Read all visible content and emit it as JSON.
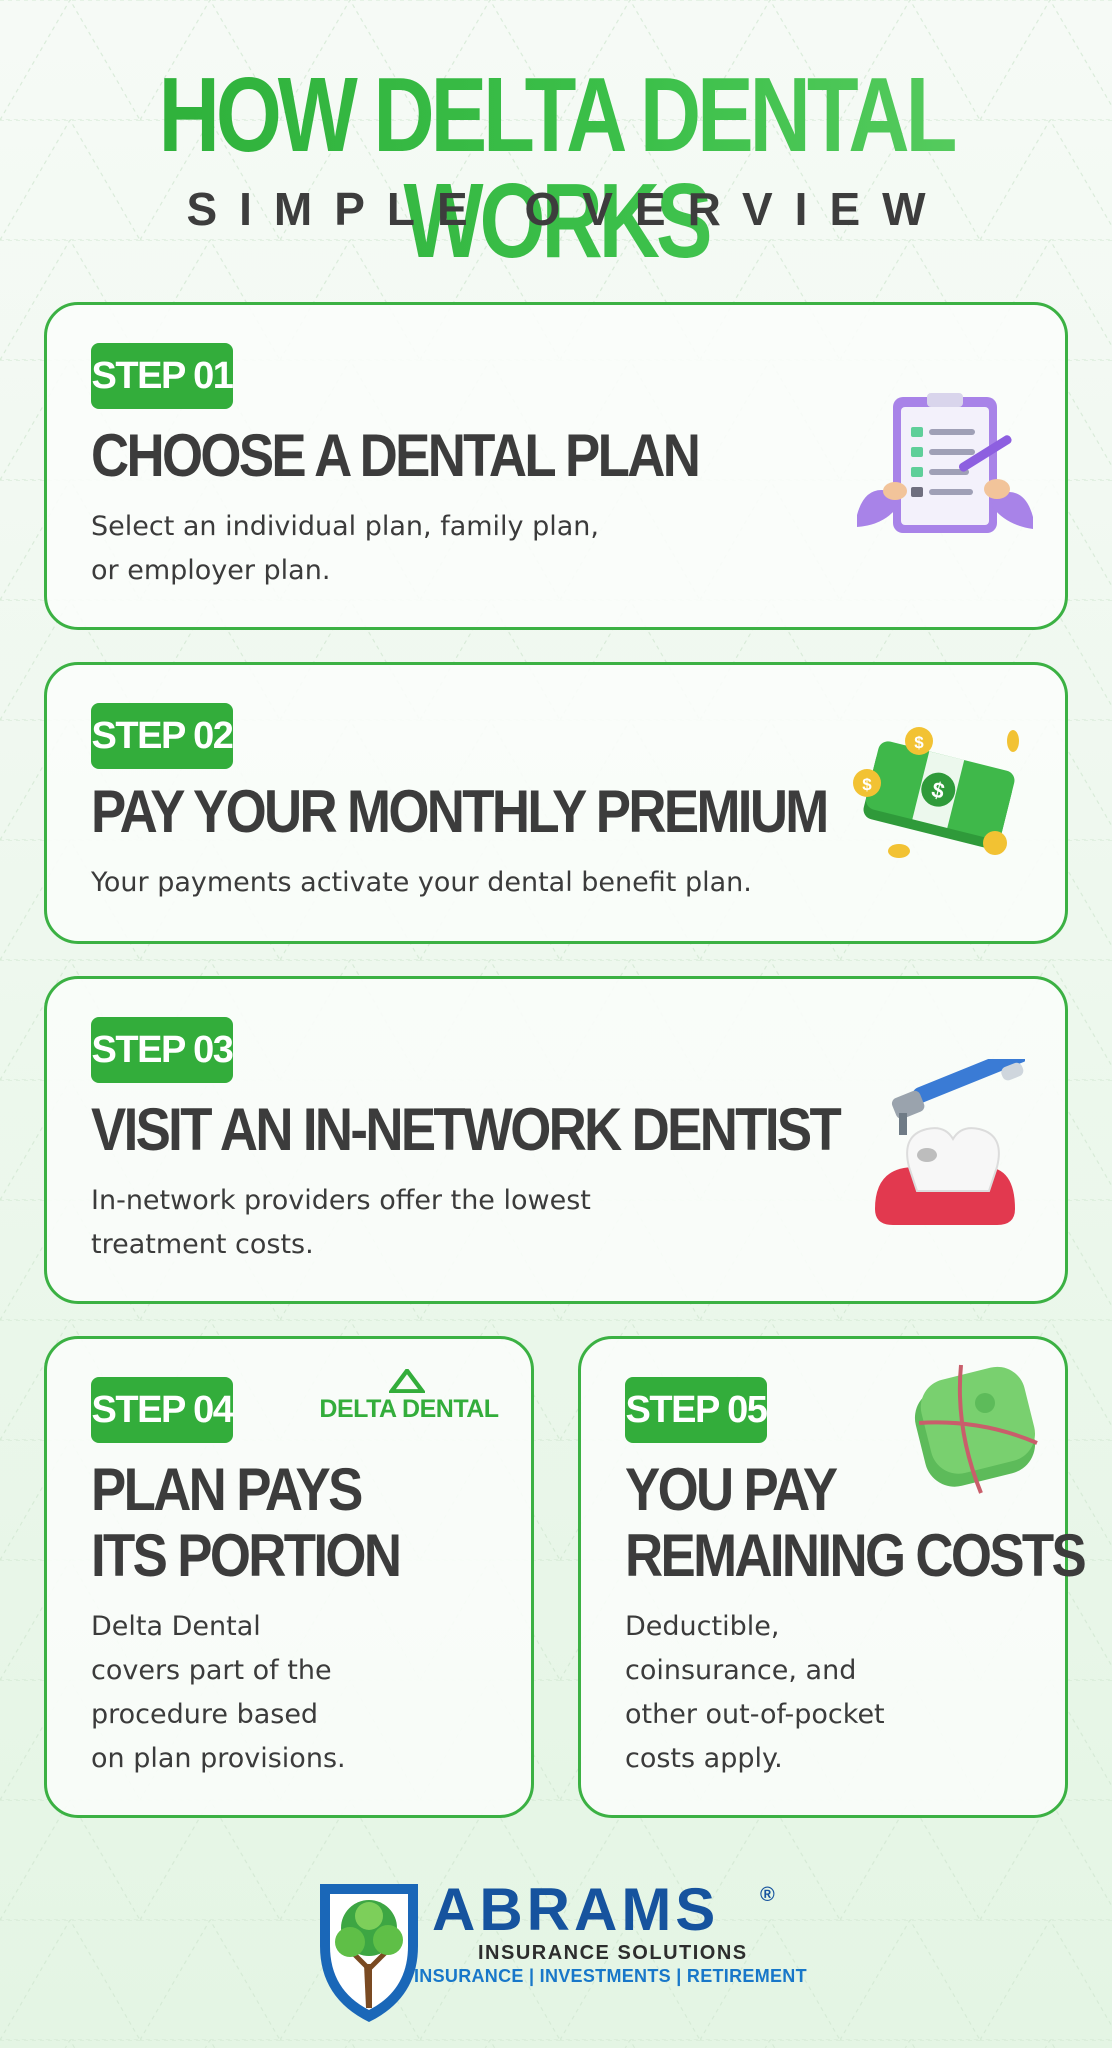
{
  "header": {
    "title": "HOW DELTA DENTAL WORKS",
    "subtitle": "SIMPLE OVERVIEW"
  },
  "steps": [
    {
      "badge": "STEP 01",
      "heading": "CHOOSE A DENTAL PLAN",
      "description_lines": [
        "Select an individual plan, family plan,",
        "or employer plan."
      ],
      "icon": "clipboard-checklist-icon"
    },
    {
      "badge": "STEP 02",
      "heading": "PAY YOUR MONTHLY PREMIUM",
      "description_lines": [
        "Your payments activate your dental benefit plan."
      ],
      "icon": "money-stack-icon"
    },
    {
      "badge": "STEP 03",
      "heading": "VISIT AN IN-NETWORK DENTIST",
      "description_lines": [
        "In-network providers offer the lowest",
        "treatment costs."
      ],
      "icon": "dental-drill-tooth-icon"
    },
    {
      "badge": "STEP 04",
      "heading_lines": [
        "PLAN PAYS",
        "ITS PORTION"
      ],
      "description_lines": [
        "Delta Dental",
        "covers part of the",
        "procedure based",
        "on plan provisions."
      ],
      "logo_text": "DELTA DENTAL",
      "icon": "delta-dental-logo"
    },
    {
      "badge": "STEP 05",
      "heading_lines": [
        "YOU PAY",
        "REMAINING COSTS"
      ],
      "description_lines": [
        "Deductible,",
        "coinsurance, and",
        "other out-of-pocket",
        "costs apply."
      ],
      "icon": "cash-roll-icon"
    }
  ],
  "footer": {
    "brand_name": "ABRAMS",
    "registered_mark": "®",
    "brand_sub": "INSURANCE SOLUTIONS",
    "tagline": "INSURANCE | INVESTMENTS | RETIREMENT",
    "icon": "tree-shield-logo"
  },
  "colors": {
    "green": "#33ad3b",
    "dark_text": "#3c3c3c",
    "brand_blue": "#16539e",
    "tag_blue": "#1877c9"
  }
}
